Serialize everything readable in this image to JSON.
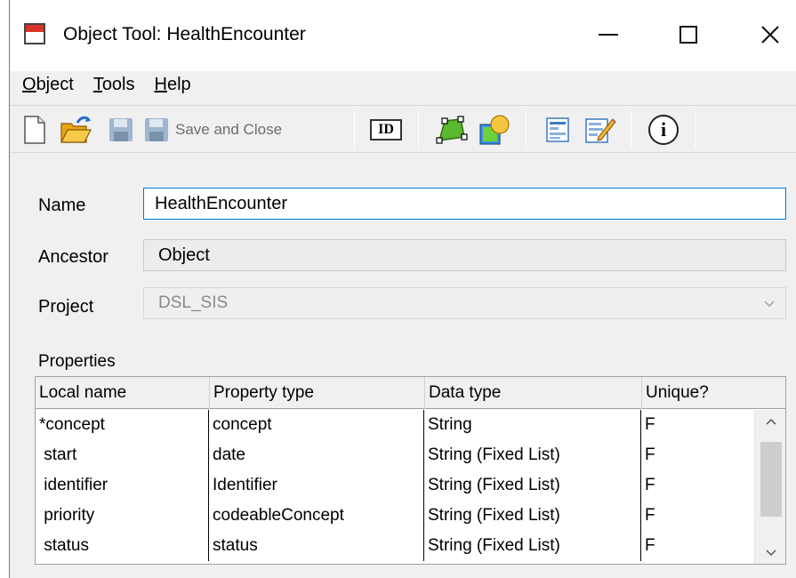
{
  "window": {
    "title": "Object Tool: HealthEncounter",
    "icon": "app-window-icon"
  },
  "menu": {
    "items": [
      {
        "underline": "O",
        "rest": "bject"
      },
      {
        "underline": "T",
        "rest": "ools"
      },
      {
        "underline": "H",
        "rest": "elp"
      }
    ]
  },
  "toolbar": {
    "save_and_close_label": "Save and Close",
    "id_label": "ID",
    "info_label": "i",
    "icons": [
      "new-icon",
      "open-icon",
      "save-icon",
      "save-and-close-icon",
      "id-icon",
      "diagram-icon",
      "shapes-icon",
      "form-icon",
      "edit-form-icon",
      "info-icon"
    ]
  },
  "form": {
    "name_label": "Name",
    "name_value": "HealthEncounter",
    "ancestor_label": "Ancestor",
    "ancestor_value": "Object",
    "project_label": "Project",
    "project_value": "DSL_SIS"
  },
  "properties": {
    "caption": "Properties",
    "columns": [
      "Local name",
      "Property type",
      "Data type",
      "Unique?"
    ],
    "rows": [
      [
        "*concept",
        "concept",
        "String",
        "F"
      ],
      [
        " start",
        "date",
        "String (Fixed List)",
        "F"
      ],
      [
        " identifier",
        "Identifier",
        "String (Fixed List)",
        "F"
      ],
      [
        " priority",
        "codeableConcept",
        "String (Fixed List)",
        "F"
      ],
      [
        " status",
        "status",
        "String (Fixed List)",
        "F"
      ]
    ]
  },
  "colors": {
    "accent": "#0078d7",
    "window_bg": "#f0f0f0",
    "title_icon_red": "#d9342b"
  }
}
